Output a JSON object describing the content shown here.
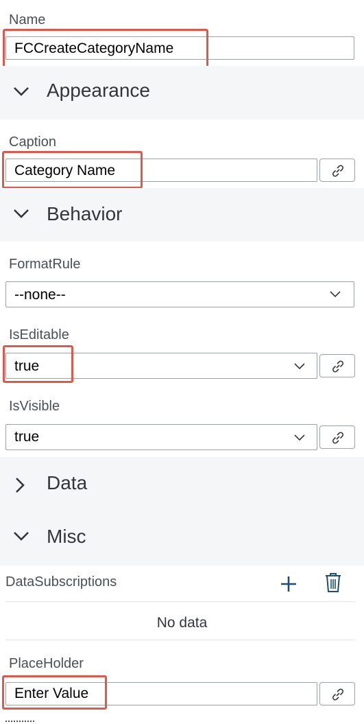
{
  "name_field": {
    "label": "Name",
    "value": "FCCreateCategoryName"
  },
  "sections": {
    "appearance": {
      "title": "Appearance",
      "expanded": true
    },
    "behavior": {
      "title": "Behavior",
      "expanded": true
    },
    "data": {
      "title": "Data",
      "expanded": false
    },
    "misc": {
      "title": "Misc",
      "expanded": true
    }
  },
  "caption_field": {
    "label": "Caption",
    "value": "Category Name"
  },
  "format_rule": {
    "label": "FormatRule",
    "value": "--none--"
  },
  "is_editable": {
    "label": "IsEditable",
    "value": "true"
  },
  "is_visible": {
    "label": "IsVisible",
    "value": "true"
  },
  "data_subscriptions": {
    "label": "DataSubscriptions",
    "empty_text": "No data"
  },
  "placeholder_field": {
    "label": "PlaceHolder",
    "value": "Enter Value"
  },
  "colors": {
    "highlight": "#e0574c",
    "section_bg": "#f5f6f7",
    "text": "#32363a"
  }
}
